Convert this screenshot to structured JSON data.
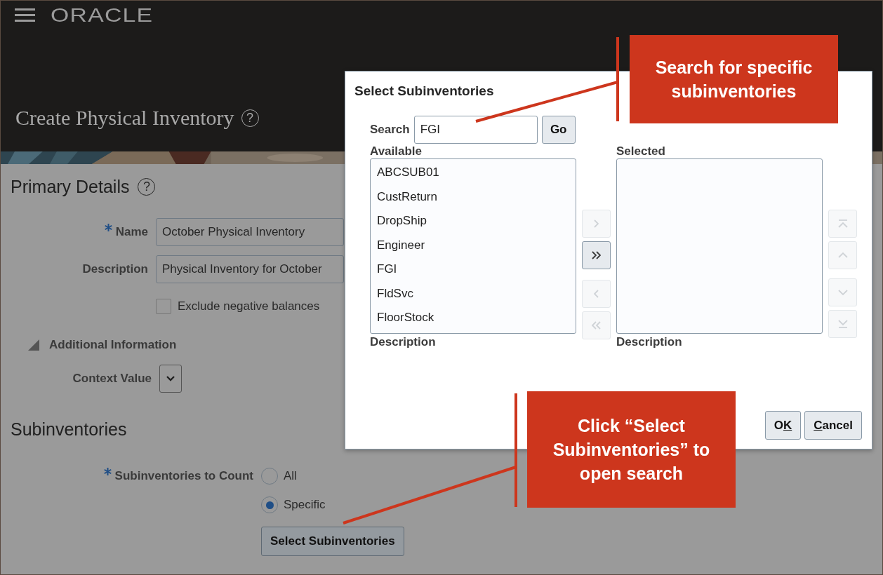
{
  "header": {
    "logo": "ORACLE",
    "page_title": "Create Physical Inventory",
    "help": "?"
  },
  "primary_details": {
    "title": "Primary Details",
    "help": "?",
    "fields": [
      {
        "label": "Name",
        "required": true,
        "value": "October Physical Inventory"
      },
      {
        "label": "Description",
        "required": false,
        "value": "Physical Inventory for October"
      }
    ],
    "checkbox": {
      "label": "Exclude negative balances",
      "checked": false
    }
  },
  "additional_information": {
    "title": "Additional Information",
    "expanded": true,
    "context_label": "Context Value"
  },
  "subinventories": {
    "title": "Subinventories",
    "label": "Subinventories to Count",
    "required": true,
    "options": [
      {
        "label": "All",
        "selected": false
      },
      {
        "label": "Specific",
        "selected": true
      }
    ],
    "button": "Select Subinventories"
  },
  "dialog": {
    "title": "Select Subinventories",
    "search_label": "Search",
    "search_value": "FGI",
    "go": "Go",
    "available_label": "Available",
    "selected_label": "Selected",
    "available": [
      "ABCSUB01",
      "CustReturn",
      "DropShip",
      "Engineer",
      "FGI",
      "FldSvc",
      "FloorStock"
    ],
    "description_labels": [
      "Description",
      "Description"
    ],
    "shuttle": [
      {
        "kind": "move",
        "disabled": true
      },
      {
        "kind": "move_all",
        "disabled": false
      },
      {
        "kind": "remove",
        "disabled": true
      },
      {
        "kind": "remove_all",
        "disabled": true
      }
    ],
    "reorder": [
      {
        "kind": "top",
        "disabled": true
      },
      {
        "kind": "up",
        "disabled": true
      },
      {
        "kind": "down",
        "disabled": true
      },
      {
        "kind": "bottom",
        "disabled": true
      }
    ],
    "buttons": [
      {
        "before": "O",
        "key": "K"
      },
      {
        "key": "C",
        "after": "ancel"
      }
    ]
  },
  "callouts": [
    {
      "text": "Search for specific subinventories"
    },
    {
      "text": "Click “Select Subinventories” to open search"
    }
  ]
}
